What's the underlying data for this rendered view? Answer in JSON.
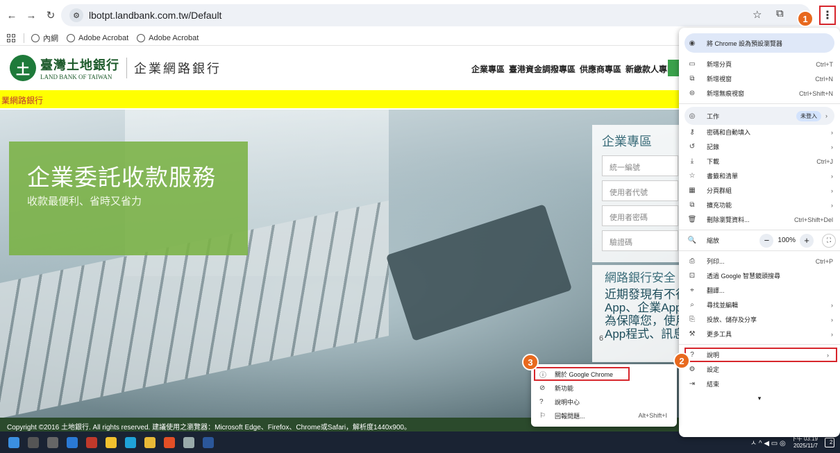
{
  "browser": {
    "url": "lbotpt.landbank.com.tw/Default",
    "bookmarks": [
      "內網",
      "Adobe Acrobat",
      "Adobe Acrobat"
    ]
  },
  "site": {
    "logo_mark": "土",
    "logo_zh": "臺灣土地銀行",
    "logo_en": "LAND BANK OF TAIWAN",
    "logo_sub": "企業網路銀行",
    "nav": [
      "企業專區",
      "臺港資金調撥專區",
      "供應商專區",
      "新繳款人專區"
    ],
    "marquee": "業網路銀行",
    "hero_title": "企業委託收款服務",
    "hero_sub": "收款最便利、省時又省力",
    "login": {
      "title": "企業專區",
      "fields": [
        "統一編號",
        "使用者代號",
        "使用者密碼",
        "驗證碼"
      ]
    },
    "notice": {
      "title": "網路銀行安全",
      "body": "近期發現有不行App、企業App，為保障您，使用App程式、訊息",
      "page_marker": "6"
    },
    "footer": "Copyright ©2016 土地銀行. All rights reserved. 建議使用之瀏覽器：Microsoft Edge、Firefox、Chrome或Safari，解析度1440x900。"
  },
  "chrome_menu": {
    "set_default": "將 Chrome 設為預設瀏覽器",
    "new_tab": "新增分頁",
    "new_tab_key": "Ctrl+T",
    "new_window": "新增視窗",
    "new_window_key": "Ctrl+N",
    "incognito": "新增無痕視窗",
    "incognito_key": "Ctrl+Shift+N",
    "profile": "工作",
    "profile_badge": "未登入",
    "passwords": "密碼和自動填入",
    "history": "記錄",
    "downloads": "下載",
    "downloads_key": "Ctrl+J",
    "bookmarks": "書籤和清單",
    "tab_groups": "分頁群組",
    "extensions": "擴充功能",
    "clear_data": "刪除瀏覽資料...",
    "clear_data_key": "Ctrl+Shift+Del",
    "zoom": "縮放",
    "zoom_value": "100%",
    "print": "列印...",
    "print_key": "Ctrl+P",
    "lens": "透過 Google 智慧鏡頭搜尋",
    "translate": "翻譯...",
    "find_edit": "尋找並編輯",
    "cast_save": "投放、儲存及分享",
    "more_tools": "更多工具",
    "help": "說明",
    "settings": "設定",
    "exit": "結束"
  },
  "help_submenu": {
    "about": "關於 Google Chrome",
    "whats_new": "新功能",
    "help_center": "說明中心",
    "report": "回報問題...",
    "report_key": "Alt+Shift+I"
  },
  "steps": [
    "1",
    "2",
    "3"
  ],
  "taskbar": {
    "clock_time": "下午 03:19",
    "clock_date": "2025/11/7",
    "notif_count": "2"
  }
}
